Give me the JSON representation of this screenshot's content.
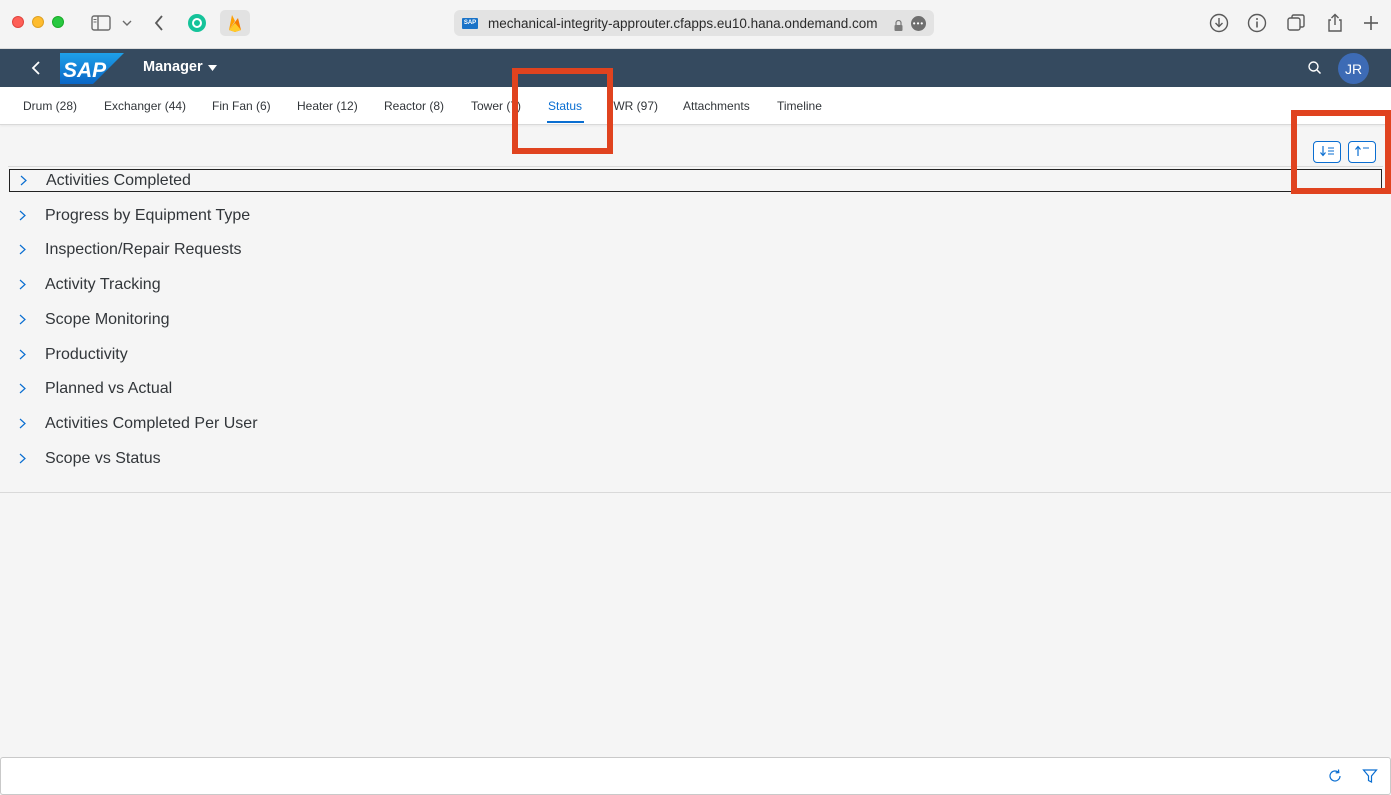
{
  "browser": {
    "url": "mechanical-integrity-approuter.cfapps.eu10.hana.ondemand.com",
    "favicon_text": "SAP"
  },
  "shell": {
    "logo_text": "SAP",
    "title": "Manager",
    "avatar_initials": "JR",
    "background": "#354a5f"
  },
  "tabs": [
    {
      "label": "Drum (28)"
    },
    {
      "label": "Exchanger (44)"
    },
    {
      "label": "Fin Fan (6)"
    },
    {
      "label": "Heater (12)"
    },
    {
      "label": "Reactor (8)"
    },
    {
      "label": "Tower (7)"
    },
    {
      "label": "Status",
      "active": true
    },
    {
      "label": "IWR (97)"
    },
    {
      "label": "Attachments"
    },
    {
      "label": "Timeline"
    }
  ],
  "toolbar": {
    "expand_all_icon": "expand-all-icon",
    "collapse_all_icon": "collapse-all-icon"
  },
  "panels": [
    {
      "title": "Activities Completed"
    },
    {
      "title": "Progress by Equipment Type"
    },
    {
      "title": "Inspection/Repair Requests"
    },
    {
      "title": "Activity Tracking"
    },
    {
      "title": "Scope Monitoring"
    },
    {
      "title": "Productivity"
    },
    {
      "title": "Planned vs Actual"
    },
    {
      "title": "Activities Completed Per User"
    },
    {
      "title": "Scope vs Status"
    }
  ],
  "colors": {
    "accent": "#0a6ed1",
    "highlight": "#e0431f"
  }
}
